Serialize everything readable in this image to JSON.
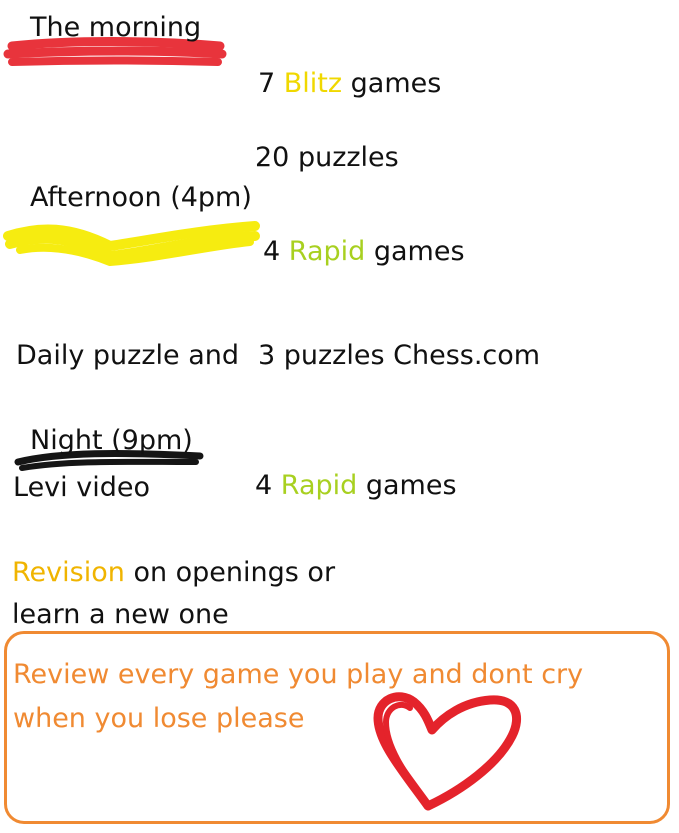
{
  "colors": {
    "morning_highlight": "#e8343c",
    "afternoon_highlight": "#f6ec10",
    "night_highlight": "#151515",
    "blitz": "#f0d800",
    "rapid": "#a8d020",
    "revision": "#f0b400",
    "note": "#f08a32",
    "heart": "#e4232b"
  },
  "morning": {
    "heading": "The morning",
    "blitz_count": "7",
    "blitz_word": "Blitz",
    "games_word": "games",
    "puzzles": "20 puzzles"
  },
  "afternoon": {
    "heading": "Afternoon (4pm)",
    "rapid_count": "4",
    "rapid_word": "Rapid",
    "games_word": "games",
    "daily_left": "Daily puzzle and",
    "daily_right": "3 puzzles Chess.com"
  },
  "night": {
    "heading": "Night (9pm)",
    "video": "Levi video",
    "rapid_count": "4",
    "rapid_word": "Rapid",
    "games_word": "games",
    "revision_word": "Revision",
    "revision_rest": "on openings or",
    "revision_line2": "learn a new one"
  },
  "note": {
    "text": "Review every game you play and dont cry when you lose please"
  },
  "icons": {
    "heart": "heart-icon"
  }
}
